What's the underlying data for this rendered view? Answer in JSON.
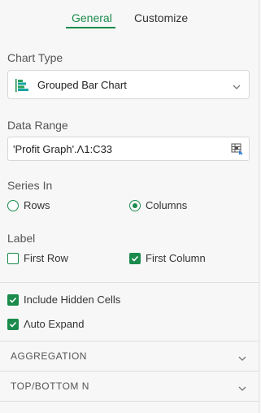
{
  "tabs": {
    "general": "General",
    "customize": "Customize"
  },
  "chart_type": {
    "label": "Chart Type",
    "value": "Grouped Bar Chart",
    "icon": "grouped-bar-chart-icon"
  },
  "data_range": {
    "label": "Data Range",
    "value": "'Profit Graph'.Λ1:C33",
    "icon": "range-select-icon"
  },
  "series_in": {
    "label": "Series In",
    "options": [
      {
        "label": "Rows",
        "selected": false
      },
      {
        "label": "Columns",
        "selected": true
      }
    ]
  },
  "label_section": {
    "label": "Label",
    "options": [
      {
        "label": "First Row",
        "checked": false
      },
      {
        "label": "First Column",
        "checked": true
      }
    ]
  },
  "options": {
    "include_hidden_cells": {
      "label": "Include Hidden Cells",
      "checked": true
    },
    "auto_expand": {
      "label": "Λuto Expand",
      "checked": true
    }
  },
  "accordions": {
    "aggregation": "AGGREGATION",
    "top_bottom_n": "TOP/BOTTOM N"
  },
  "colors": {
    "accent": "#1a8b4c",
    "chart_icon_green": "#2aa05a",
    "chart_icon_teal": "#18a3a3"
  }
}
